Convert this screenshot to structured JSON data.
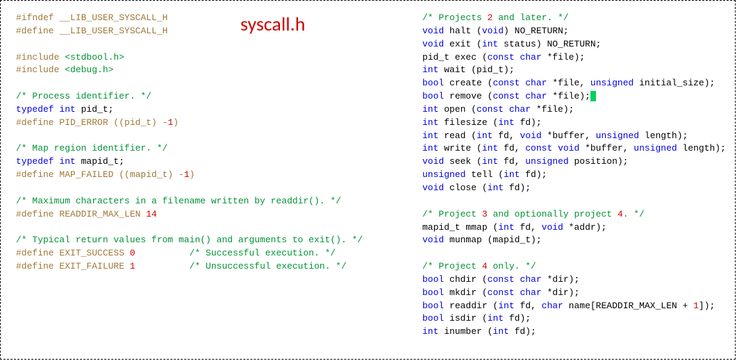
{
  "title": "syscall.h",
  "left": {
    "l1a": "#ifndef",
    "l1b": "__LIB_USER_SYSCALL_H",
    "l2a": "#define",
    "l2b": "__LIB_USER_SYSCALL_H",
    "l3a": "#include ",
    "l3b": "<stdbool.h>",
    "l4a": "#include ",
    "l4b": "<debug.h>",
    "c1": "/* Process identifier. */",
    "l5a": "typedef",
    "l5b": " int",
    "l5c": " pid_t;",
    "l6a": "#define",
    "l6b": " PID_ERROR ((pid_t) -",
    "l6c": "1",
    "l6d": ")",
    "c2": "/* Map region identifier. */",
    "l7a": "typedef",
    "l7b": " int",
    "l7c": " mapid_t;",
    "l8a": "#define",
    "l8b": " MAP_FAILED ((mapid_t) -",
    "l8c": "1",
    "l8d": ")",
    "c3": "/* Maximum characters in a filename written by readdir(). */",
    "l9a": "#define",
    "l9b": " READDIR_MAX_LEN ",
    "l9c": "14",
    "c4": "/* Typical return values from main() and arguments to exit(). */",
    "l10a": "#define",
    "l10b": " EXIT_SUCCESS ",
    "l10c": "0",
    "l10pad": "          ",
    "l10cmt": "/* Successful execution. */",
    "l11a": "#define",
    "l11b": " EXIT_FAILURE ",
    "l11c": "1",
    "l11pad": "          ",
    "l11cmt": "/* Unsuccessful execution. */"
  },
  "right": {
    "c1a": "/* Projects ",
    "c1n": "2",
    "c1b": " and later. */",
    "r1a": "void",
    "r1b": " halt (",
    "r1c": "void",
    "r1d": ") NO_RETURN;",
    "r2a": "void",
    "r2b": " exit (",
    "r2c": "int",
    "r2d": " status) NO_RETURN;",
    "r3a": "pid_t exec (",
    "r3b": "const",
    "r3c": " char",
    "r3d": " *file);",
    "r4a": "int",
    "r4b": " wait (pid_t);",
    "r5a": "bool",
    "r5b": " create (",
    "r5c": "const",
    "r5d": " char",
    "r5e": " *file, ",
    "r5f": "unsigned",
    "r5g": " initial_size);",
    "r6a": "bool",
    "r6b": " remove (",
    "r6c": "const",
    "r6d": " char",
    "r6e": " *file);",
    "r7a": "int",
    "r7b": " open (",
    "r7c": "const",
    "r7d": " char",
    "r7e": " *file);",
    "r8a": "int",
    "r8b": " filesize (",
    "r8c": "int",
    "r8d": " fd);",
    "r9a": "int",
    "r9b": " read (",
    "r9c": "int",
    "r9d": " fd, ",
    "r9e": "void",
    "r9f": " *buffer, ",
    "r9g": "unsigned",
    "r9h": " length);",
    "r10a": "int",
    "r10b": " write (",
    "r10c": "int",
    "r10d": " fd, ",
    "r10e": "const",
    "r10f": " void",
    "r10g": " *buffer, ",
    "r10h": "unsigned",
    "r10i": " length);",
    "r11a": "void",
    "r11b": " seek (",
    "r11c": "int",
    "r11d": " fd, ",
    "r11e": "unsigned",
    "r11f": " position);",
    "r12a": "unsigned",
    "r12b": " tell (",
    "r12c": "int",
    "r12d": " fd);",
    "r13a": "void",
    "r13b": " close (",
    "r13c": "int",
    "r13d": " fd);",
    "c2a": "/* Project ",
    "c2n1": "3",
    "c2b": " and optionally project ",
    "c2n2": "4",
    "c2c": ". */",
    "r14a": "mapid_t mmap (",
    "r14b": "int",
    "r14c": " fd, ",
    "r14d": "void",
    "r14e": " *addr);",
    "r15a": "void",
    "r15b": " munmap (mapid_t);",
    "c3a": "/* Project ",
    "c3n": "4",
    "c3b": " only. */",
    "r16a": "bool",
    "r16b": " chdir (",
    "r16c": "const",
    "r16d": " char",
    "r16e": " *dir);",
    "r17a": "bool",
    "r17b": " mkdir (",
    "r17c": "const",
    "r17d": " char",
    "r17e": " *dir);",
    "r18a": "bool",
    "r18b": " readdir (",
    "r18c": "int",
    "r18d": " fd, ",
    "r18e": "char",
    "r18f": " name[READDIR_MAX_LEN + ",
    "r18g": "1",
    "r18h": "]);",
    "r19a": "bool",
    "r19b": " isdir (",
    "r19c": "int",
    "r19d": " fd);",
    "r20a": "int",
    "r20b": " inumber (",
    "r20c": "int",
    "r20d": " fd);"
  }
}
